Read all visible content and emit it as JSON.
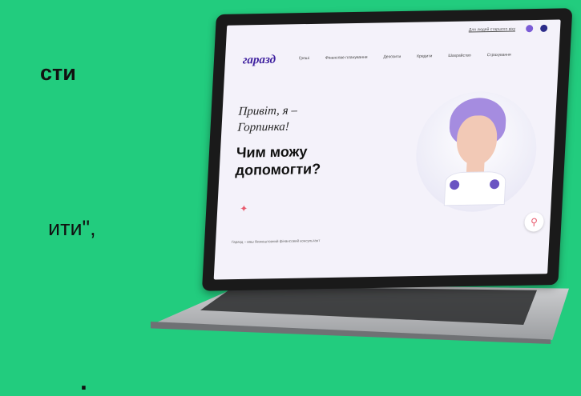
{
  "left_text": {
    "line1": "сти",
    "line2": "ити\",",
    "line3": "."
  },
  "site": {
    "top_link": "Для людей старшого віку",
    "logo": "гаразд",
    "nav": [
      "Гроші",
      "Фінансове планування",
      "Депозити",
      "Кредити",
      "Шахрайство",
      "Страхування"
    ],
    "hero": {
      "greeting_line1": "Привіт, я –",
      "greeting_line2": "Горпинка!",
      "question_line1": "Чим можу",
      "question_line2": "допомогти?"
    },
    "footer_text": "Гаразд – ваш безкоштовний фінансовий консультант",
    "search_icon": "search-icon",
    "sparkle_icon": "sparkle-icon"
  },
  "colors": {
    "background": "#22cc7e",
    "brand": "#3d1f9e",
    "accent": "#e85a6d"
  }
}
